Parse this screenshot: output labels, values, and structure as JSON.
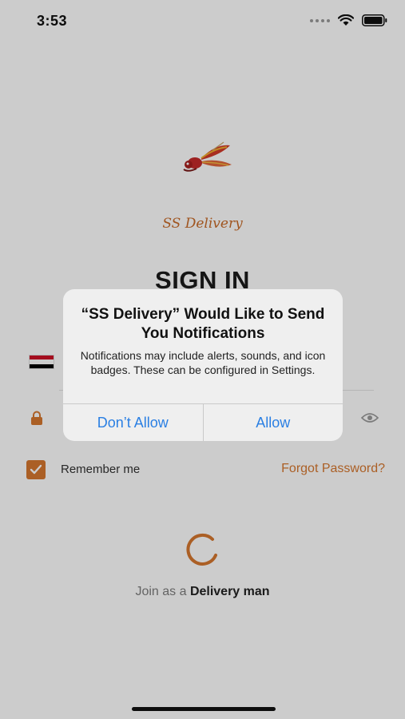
{
  "status_bar": {
    "time": "3:53",
    "icons": [
      "signal-dots-icon",
      "wifi-icon",
      "battery-icon"
    ]
  },
  "app": {
    "brand": "SS Delivery",
    "title": "SIGN IN"
  },
  "form": {
    "phone_icon": "egypt-flag-icon",
    "phone_value": "",
    "password_value": "",
    "password_icon": "lock-icon",
    "visibility_icon": "eye-icon",
    "remember_label": "Remember me",
    "remember_checked": true,
    "forgot_label": "Forgot Password?"
  },
  "join": {
    "prefix": "Join as a",
    "link": "Delivery man"
  },
  "alert": {
    "title": "“SS Delivery” Would Like to Send You Notifications",
    "message": "Notifications may include alerts, sounds, and icon badges. These can be configured in Settings.",
    "deny_label": "Don’t Allow",
    "allow_label": "Allow"
  },
  "colors": {
    "accent": "#d6772f",
    "alert_button": "#2a7fe3",
    "overlay": "rgba(0,0,0,0.2)"
  }
}
